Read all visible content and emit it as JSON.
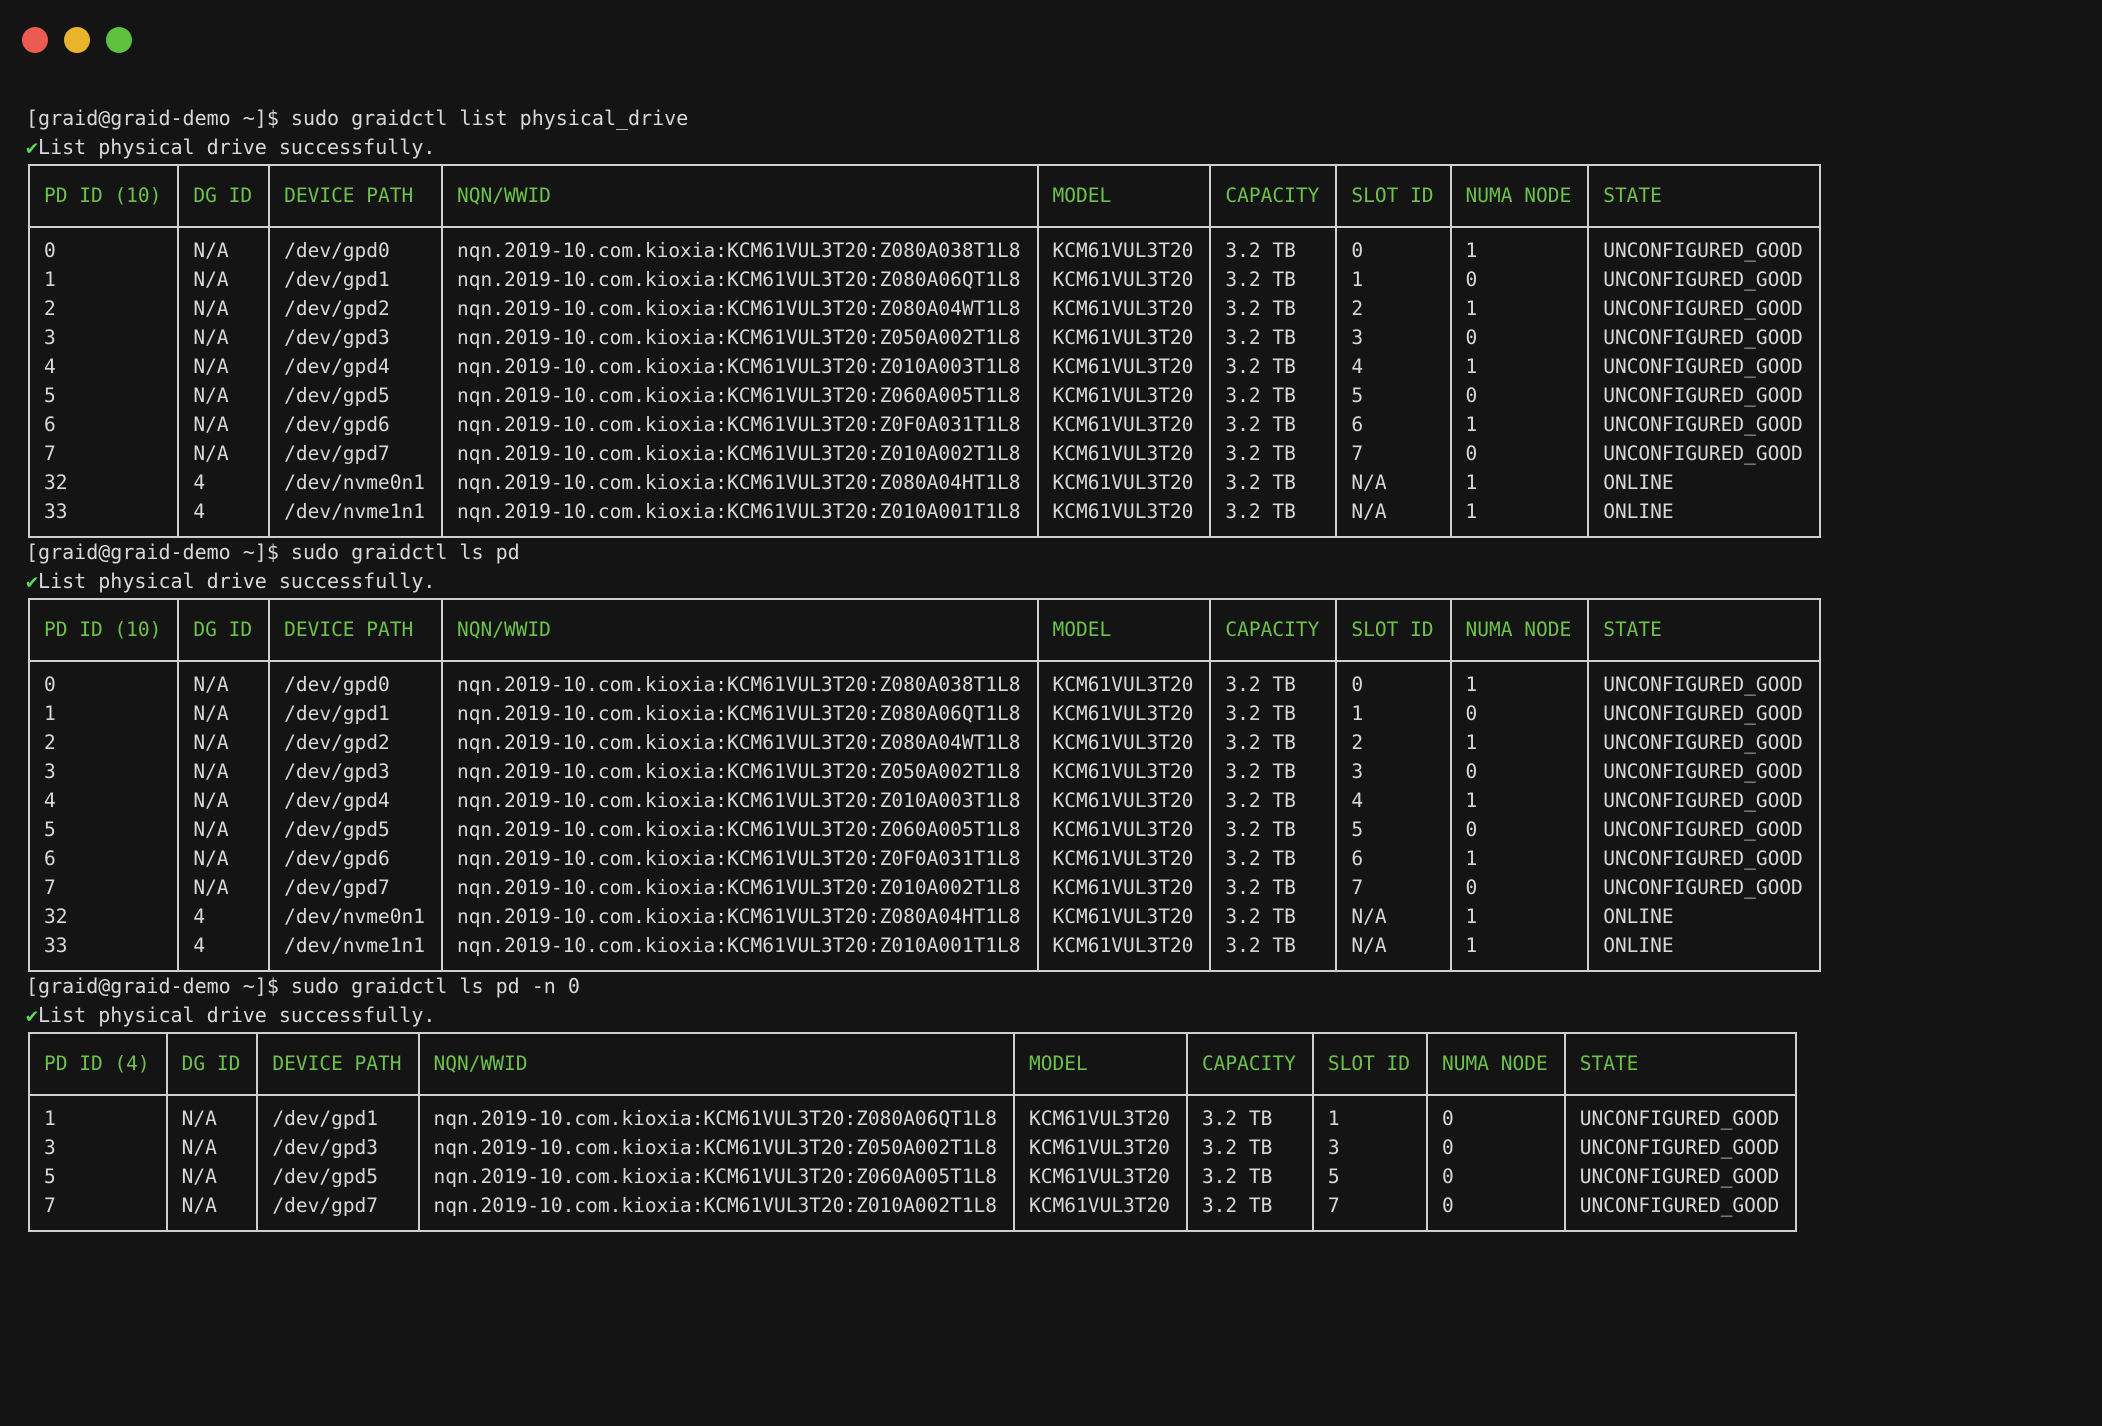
{
  "window": {
    "controls": {
      "close_color": "#ec5b52",
      "minimize_color": "#e9b429",
      "maximize_color": "#5fc13f"
    }
  },
  "colors": {
    "header_text": "#6cc24a",
    "body_text": "#d8d8d8",
    "check": "#5fd35f",
    "background": "#141414"
  },
  "blocks": [
    {
      "command": "[graid@graid-demo ~]$ sudo graidctl list physical_drive",
      "status_check": "✔",
      "status": "List physical drive successfully.",
      "headers": [
        "PD ID (10)",
        "DG ID",
        "DEVICE PATH",
        "NQN/WWID",
        "MODEL",
        "CAPACITY",
        "SLOT ID",
        "NUMA NODE",
        "STATE"
      ],
      "rows": [
        [
          "0",
          "N/A",
          "/dev/gpd0",
          "nqn.2019-10.com.kioxia:KCM61VUL3T20:Z080A038T1L8",
          "KCM61VUL3T20",
          "3.2 TB",
          "0",
          "1",
          "UNCONFIGURED_GOOD"
        ],
        [
          "1",
          "N/A",
          "/dev/gpd1",
          "nqn.2019-10.com.kioxia:KCM61VUL3T20:Z080A06QT1L8",
          "KCM61VUL3T20",
          "3.2 TB",
          "1",
          "0",
          "UNCONFIGURED_GOOD"
        ],
        [
          "2",
          "N/A",
          "/dev/gpd2",
          "nqn.2019-10.com.kioxia:KCM61VUL3T20:Z080A04WT1L8",
          "KCM61VUL3T20",
          "3.2 TB",
          "2",
          "1",
          "UNCONFIGURED_GOOD"
        ],
        [
          "3",
          "N/A",
          "/dev/gpd3",
          "nqn.2019-10.com.kioxia:KCM61VUL3T20:Z050A002T1L8",
          "KCM61VUL3T20",
          "3.2 TB",
          "3",
          "0",
          "UNCONFIGURED_GOOD"
        ],
        [
          "4",
          "N/A",
          "/dev/gpd4",
          "nqn.2019-10.com.kioxia:KCM61VUL3T20:Z010A003T1L8",
          "KCM61VUL3T20",
          "3.2 TB",
          "4",
          "1",
          "UNCONFIGURED_GOOD"
        ],
        [
          "5",
          "N/A",
          "/dev/gpd5",
          "nqn.2019-10.com.kioxia:KCM61VUL3T20:Z060A005T1L8",
          "KCM61VUL3T20",
          "3.2 TB",
          "5",
          "0",
          "UNCONFIGURED_GOOD"
        ],
        [
          "6",
          "N/A",
          "/dev/gpd6",
          "nqn.2019-10.com.kioxia:KCM61VUL3T20:Z0F0A031T1L8",
          "KCM61VUL3T20",
          "3.2 TB",
          "6",
          "1",
          "UNCONFIGURED_GOOD"
        ],
        [
          "7",
          "N/A",
          "/dev/gpd7",
          "nqn.2019-10.com.kioxia:KCM61VUL3T20:Z010A002T1L8",
          "KCM61VUL3T20",
          "3.2 TB",
          "7",
          "0",
          "UNCONFIGURED_GOOD"
        ],
        [
          "32",
          "4",
          "/dev/nvme0n1",
          "nqn.2019-10.com.kioxia:KCM61VUL3T20:Z080A04HT1L8",
          "KCM61VUL3T20",
          "3.2 TB",
          "N/A",
          "1",
          "ONLINE"
        ],
        [
          "33",
          "4",
          "/dev/nvme1n1",
          "nqn.2019-10.com.kioxia:KCM61VUL3T20:Z010A001T1L8",
          "KCM61VUL3T20",
          "3.2 TB",
          "N/A",
          "1",
          "ONLINE"
        ]
      ]
    },
    {
      "command": "[graid@graid-demo ~]$ sudo graidctl ls pd",
      "status_check": "✔",
      "status": "List physical drive successfully.",
      "headers": [
        "PD ID (10)",
        "DG ID",
        "DEVICE PATH",
        "NQN/WWID",
        "MODEL",
        "CAPACITY",
        "SLOT ID",
        "NUMA NODE",
        "STATE"
      ],
      "rows": [
        [
          "0",
          "N/A",
          "/dev/gpd0",
          "nqn.2019-10.com.kioxia:KCM61VUL3T20:Z080A038T1L8",
          "KCM61VUL3T20",
          "3.2 TB",
          "0",
          "1",
          "UNCONFIGURED_GOOD"
        ],
        [
          "1",
          "N/A",
          "/dev/gpd1",
          "nqn.2019-10.com.kioxia:KCM61VUL3T20:Z080A06QT1L8",
          "KCM61VUL3T20",
          "3.2 TB",
          "1",
          "0",
          "UNCONFIGURED_GOOD"
        ],
        [
          "2",
          "N/A",
          "/dev/gpd2",
          "nqn.2019-10.com.kioxia:KCM61VUL3T20:Z080A04WT1L8",
          "KCM61VUL3T20",
          "3.2 TB",
          "2",
          "1",
          "UNCONFIGURED_GOOD"
        ],
        [
          "3",
          "N/A",
          "/dev/gpd3",
          "nqn.2019-10.com.kioxia:KCM61VUL3T20:Z050A002T1L8",
          "KCM61VUL3T20",
          "3.2 TB",
          "3",
          "0",
          "UNCONFIGURED_GOOD"
        ],
        [
          "4",
          "N/A",
          "/dev/gpd4",
          "nqn.2019-10.com.kioxia:KCM61VUL3T20:Z010A003T1L8",
          "KCM61VUL3T20",
          "3.2 TB",
          "4",
          "1",
          "UNCONFIGURED_GOOD"
        ],
        [
          "5",
          "N/A",
          "/dev/gpd5",
          "nqn.2019-10.com.kioxia:KCM61VUL3T20:Z060A005T1L8",
          "KCM61VUL3T20",
          "3.2 TB",
          "5",
          "0",
          "UNCONFIGURED_GOOD"
        ],
        [
          "6",
          "N/A",
          "/dev/gpd6",
          "nqn.2019-10.com.kioxia:KCM61VUL3T20:Z0F0A031T1L8",
          "KCM61VUL3T20",
          "3.2 TB",
          "6",
          "1",
          "UNCONFIGURED_GOOD"
        ],
        [
          "7",
          "N/A",
          "/dev/gpd7",
          "nqn.2019-10.com.kioxia:KCM61VUL3T20:Z010A002T1L8",
          "KCM61VUL3T20",
          "3.2 TB",
          "7",
          "0",
          "UNCONFIGURED_GOOD"
        ],
        [
          "32",
          "4",
          "/dev/nvme0n1",
          "nqn.2019-10.com.kioxia:KCM61VUL3T20:Z080A04HT1L8",
          "KCM61VUL3T20",
          "3.2 TB",
          "N/A",
          "1",
          "ONLINE"
        ],
        [
          "33",
          "4",
          "/dev/nvme1n1",
          "nqn.2019-10.com.kioxia:KCM61VUL3T20:Z010A001T1L8",
          "KCM61VUL3T20",
          "3.2 TB",
          "N/A",
          "1",
          "ONLINE"
        ]
      ]
    },
    {
      "command": "[graid@graid-demo ~]$ sudo graidctl ls pd -n 0",
      "status_check": "✔",
      "status": "List physical drive successfully.",
      "headers": [
        "PD ID (4)",
        "DG ID",
        "DEVICE PATH",
        "NQN/WWID",
        "MODEL",
        "CAPACITY",
        "SLOT ID",
        "NUMA NODE",
        "STATE"
      ],
      "rows": [
        [
          "1",
          "N/A",
          "/dev/gpd1",
          "nqn.2019-10.com.kioxia:KCM61VUL3T20:Z080A06QT1L8",
          "KCM61VUL3T20",
          "3.2 TB",
          "1",
          "0",
          "UNCONFIGURED_GOOD"
        ],
        [
          "3",
          "N/A",
          "/dev/gpd3",
          "nqn.2019-10.com.kioxia:KCM61VUL3T20:Z050A002T1L8",
          "KCM61VUL3T20",
          "3.2 TB",
          "3",
          "0",
          "UNCONFIGURED_GOOD"
        ],
        [
          "5",
          "N/A",
          "/dev/gpd5",
          "nqn.2019-10.com.kioxia:KCM61VUL3T20:Z060A005T1L8",
          "KCM61VUL3T20",
          "3.2 TB",
          "5",
          "0",
          "UNCONFIGURED_GOOD"
        ],
        [
          "7",
          "N/A",
          "/dev/gpd7",
          "nqn.2019-10.com.kioxia:KCM61VUL3T20:Z010A002T1L8",
          "KCM61VUL3T20",
          "3.2 TB",
          "7",
          "0",
          "UNCONFIGURED_GOOD"
        ]
      ]
    }
  ]
}
